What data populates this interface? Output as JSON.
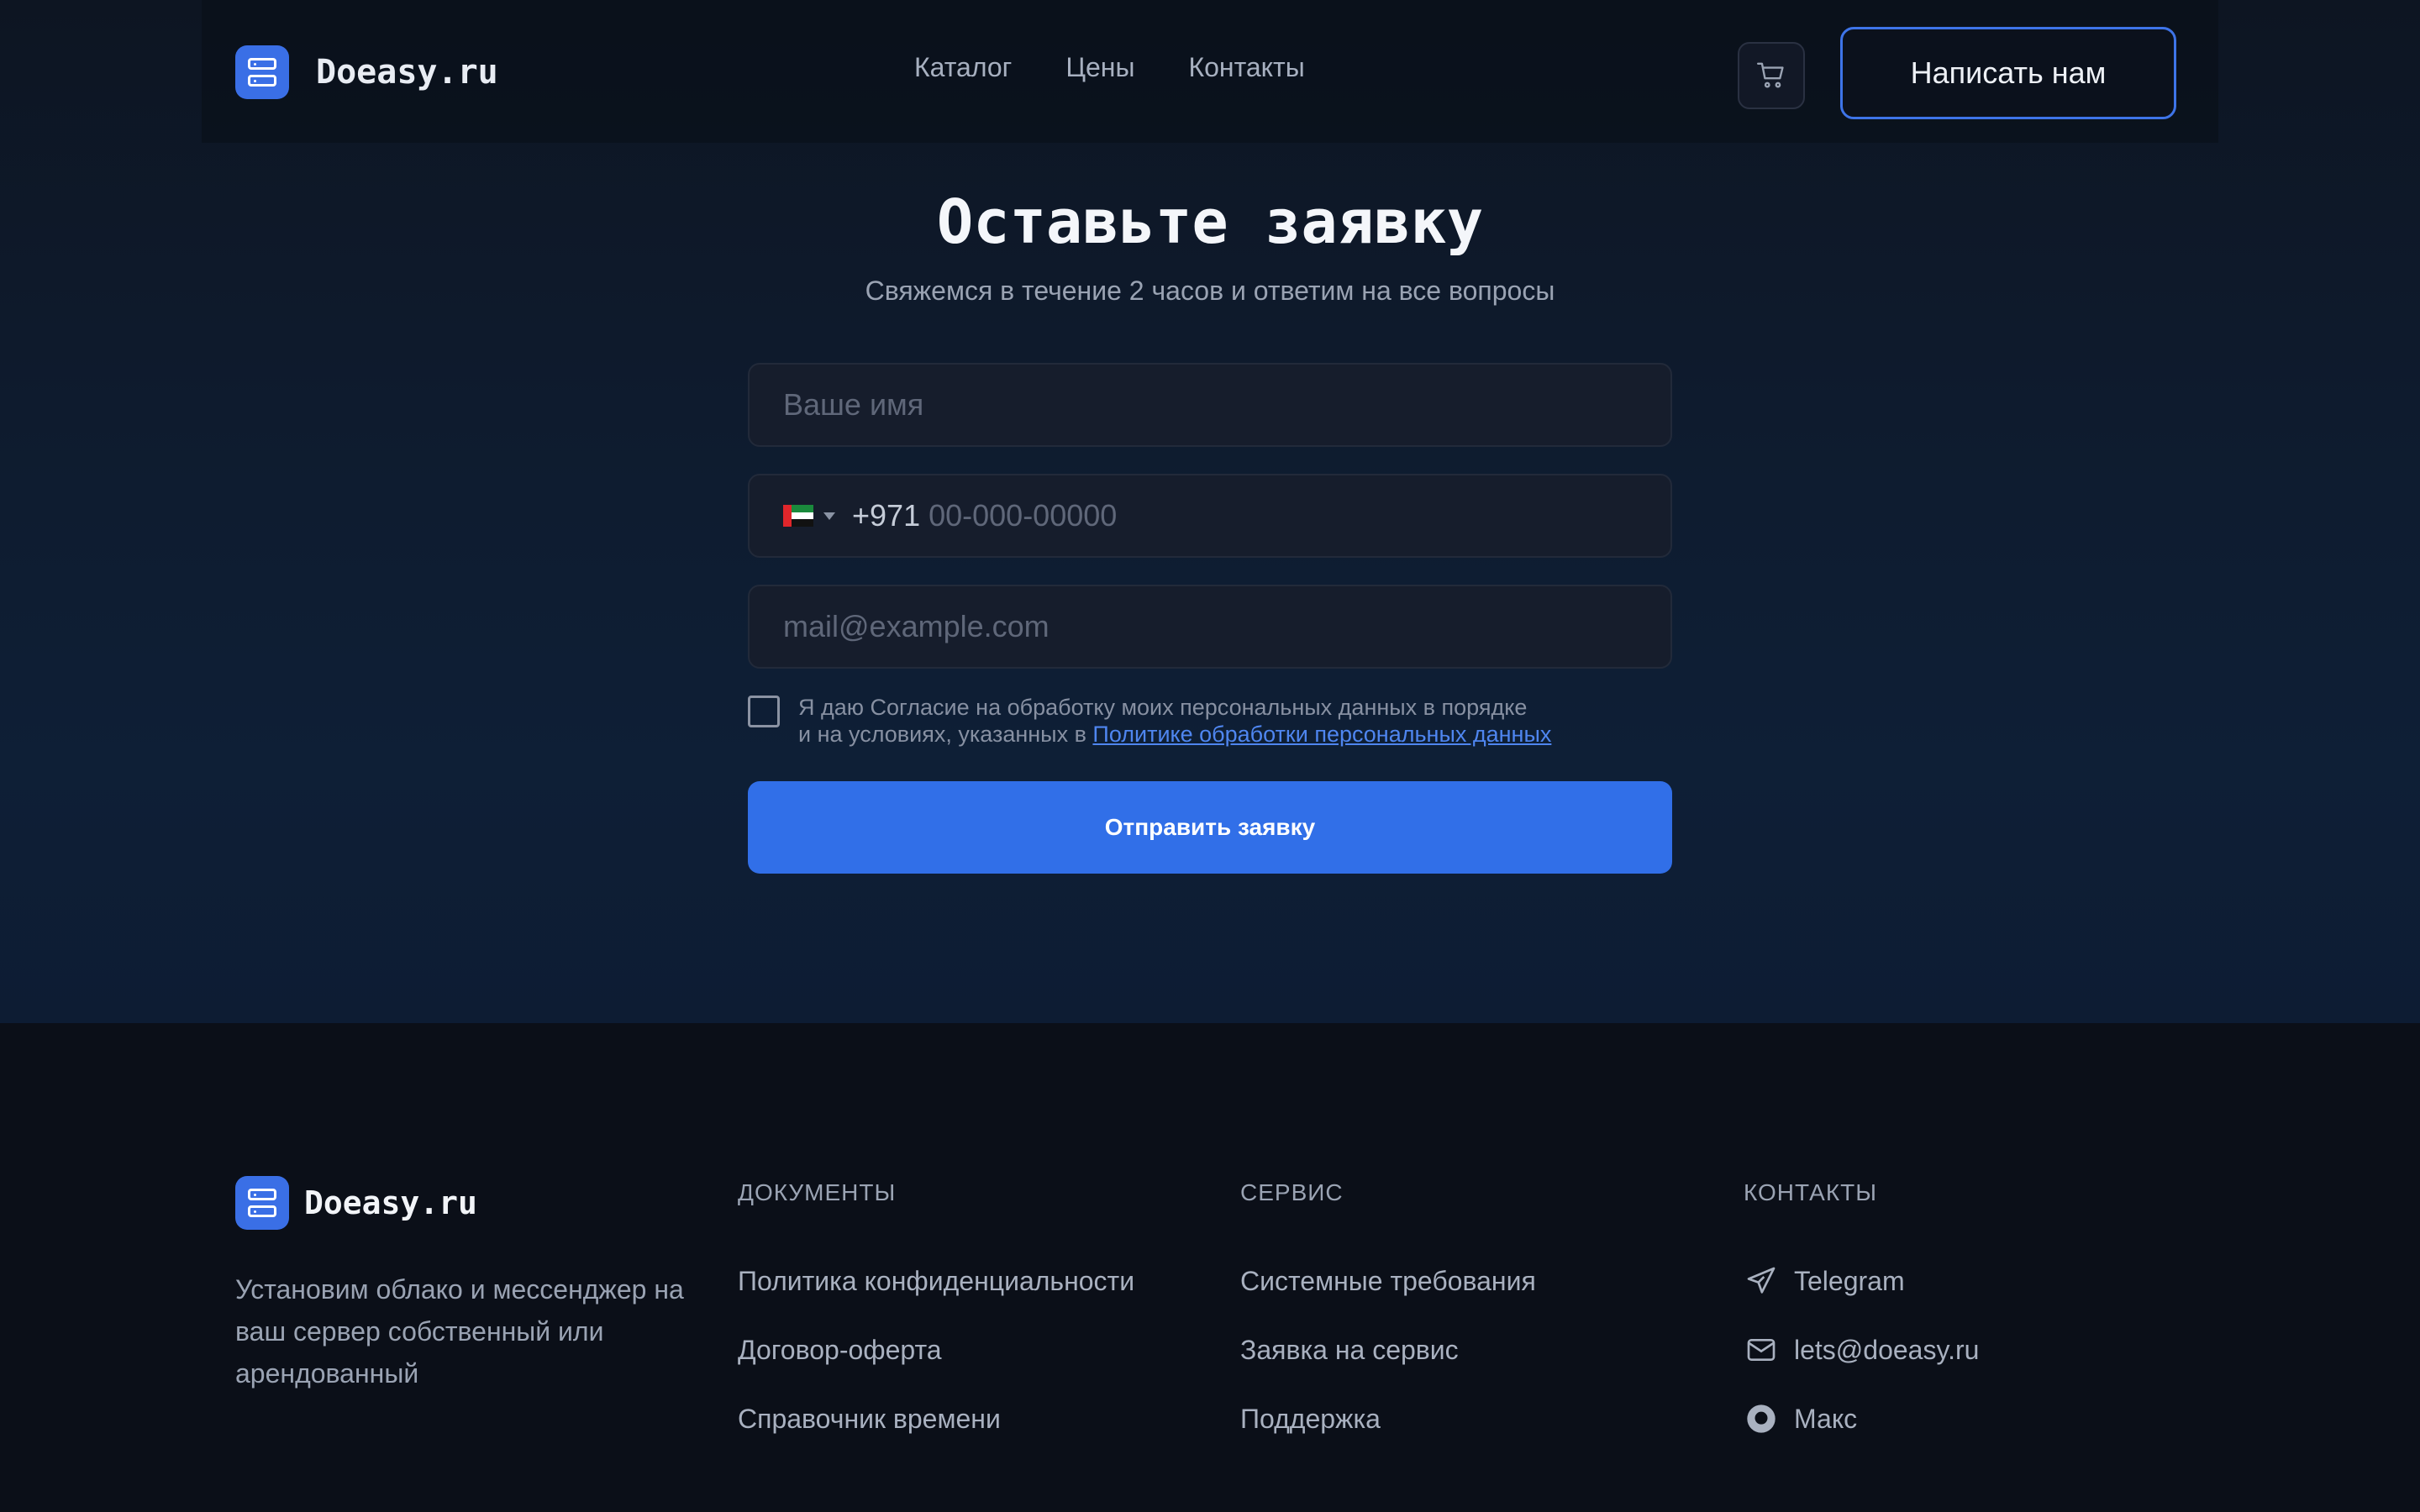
{
  "header": {
    "brand": "Doeasy.ru",
    "nav": [
      "Каталог",
      "Цены",
      "Контакты"
    ],
    "cart_icon": "cart-icon",
    "cta_label": "Написать нам"
  },
  "form": {
    "title": "Оставьте заявку",
    "subtitle": "Свяжемся в течение 2 часов и ответим на все вопросы",
    "name_placeholder": "Ваше имя",
    "phone_country": "AE",
    "phone_dial_code": "+971",
    "phone_placeholder": "00-000-00000",
    "email_placeholder": "mail@example.com",
    "consent_line1": "Я даю Согласие на обработку моих персональных данных в порядке",
    "consent_line2_prefix": "и на условиях, указанных в ",
    "consent_link": "Политике обработки персональных данных",
    "submit_label": "Отправить заявку"
  },
  "footer": {
    "brand": "Doeasy.ru",
    "description": "Установим облако и мессенджер на ваш сервер собственный или арендованный",
    "docs": {
      "heading": "ДОКУМЕНТЫ",
      "items": [
        "Политика конфиденциальности",
        "Договор-оферта",
        "Справочник времени"
      ]
    },
    "service": {
      "heading": "СЕРВИС",
      "items": [
        "Системные требования",
        "Заявка на сервис",
        "Поддержка"
      ]
    },
    "contacts": {
      "heading": "КОНТАКТЫ",
      "items": [
        {
          "icon": "telegram-icon",
          "label": "Telegram"
        },
        {
          "icon": "mail-icon",
          "label": "lets@doeasy.ru"
        },
        {
          "icon": "chat-icon",
          "label": "Макс"
        }
      ]
    }
  },
  "colors": {
    "accent": "#316fe8",
    "background": "#0b0f18",
    "text_muted": "#9aa3b3"
  }
}
